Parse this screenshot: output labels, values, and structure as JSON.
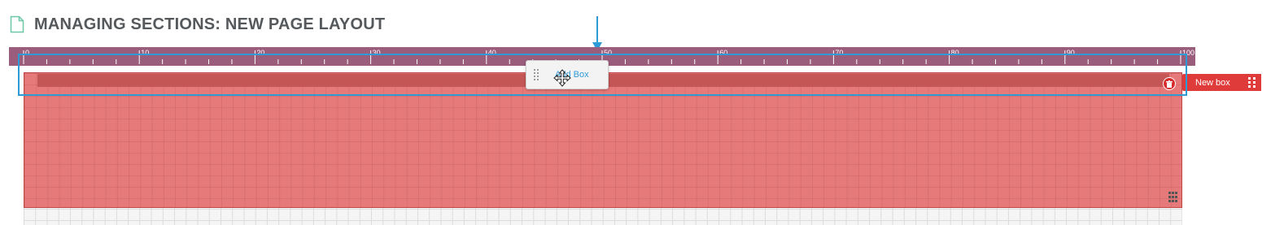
{
  "header": {
    "icon": "document-icon",
    "title": "MANAGING SECTIONS: NEW PAGE LAYOUT"
  },
  "ruler": {
    "labels": [
      "0",
      "10",
      "20",
      "30",
      "40",
      "50",
      "60",
      "70",
      "80",
      "90",
      "100"
    ],
    "min": 0,
    "max": 100
  },
  "section": {
    "box_label": "New box",
    "delete_icon": "trash-icon",
    "grip_icon": "drag-handle-icon",
    "resize_icon": "resize-handle-icon"
  },
  "floating": {
    "label": "Add Box",
    "cursor_icon": "move-cursor-icon"
  },
  "colors": {
    "ruler": "#9a5d7c",
    "section": "#e67a7a",
    "tag": "#e03b3b",
    "selection": "#2e9bd6",
    "arrow": "#2e9bd6"
  }
}
